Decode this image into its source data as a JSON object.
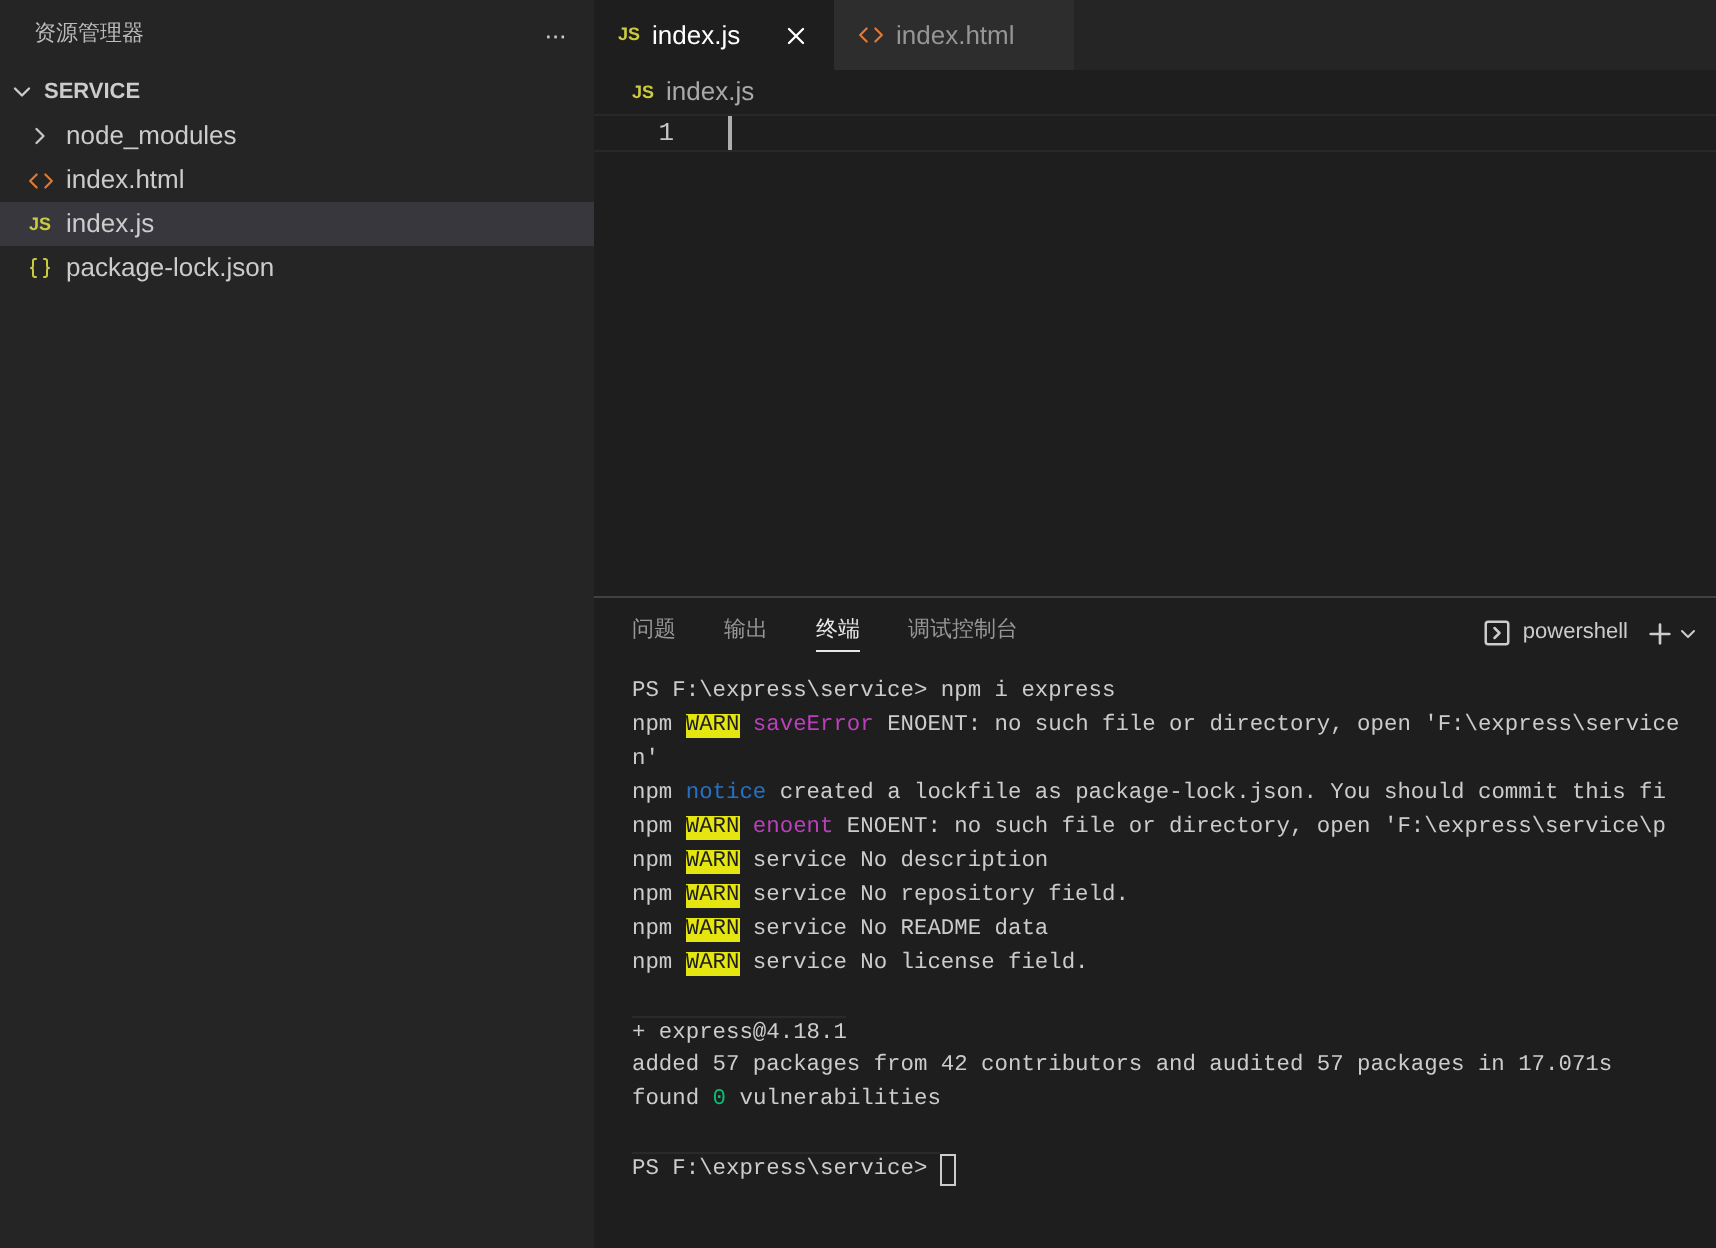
{
  "sidebar": {
    "title": "资源管理器",
    "more": "···",
    "folder": {
      "name": "SERVICE",
      "expanded": true
    },
    "items": [
      {
        "kind": "folder",
        "name": "node_modules",
        "selected": false
      },
      {
        "kind": "html",
        "name": "index.html",
        "selected": false
      },
      {
        "kind": "js",
        "icon_label": "JS",
        "name": "index.js",
        "selected": true
      },
      {
        "kind": "json",
        "name": "package-lock.json",
        "selected": false
      }
    ]
  },
  "tabs": [
    {
      "kind": "js",
      "icon_label": "JS",
      "label": "index.js",
      "selected": true
    },
    {
      "kind": "html",
      "label": "index.html",
      "selected": false
    }
  ],
  "breadcrumb": {
    "kind": "js",
    "icon_label": "JS",
    "label": "index.js"
  },
  "editor": {
    "line_numbers": [
      "1"
    ]
  },
  "panel": {
    "tabs": [
      {
        "label": "问题",
        "selected": false
      },
      {
        "label": "输出",
        "selected": false
      },
      {
        "label": "终端",
        "selected": true
      },
      {
        "label": "调试控制台",
        "selected": false
      }
    ],
    "shell": "powershell",
    "terminal": [
      {
        "segments": [
          {
            "kind": "plain",
            "text": "PS F:\\express\\service> npm i express"
          }
        ]
      },
      {
        "segments": [
          {
            "kind": "plain",
            "text": "npm "
          },
          {
            "kind": "warn",
            "text": "WARN"
          },
          {
            "kind": "keyword",
            "text": " saveError"
          },
          {
            "kind": "plain",
            "text": " ENOENT: no such file or directory, open 'F:\\express\\service"
          }
        ]
      },
      {
        "segments": [
          {
            "kind": "plain",
            "text": "n'"
          }
        ]
      },
      {
        "segments": [
          {
            "kind": "plain",
            "text": "npm "
          },
          {
            "kind": "notice",
            "text": "notice"
          },
          {
            "kind": "plain",
            "text": " created a lockfile as package-lock.json. You should commit this fi"
          }
        ]
      },
      {
        "segments": [
          {
            "kind": "plain",
            "text": "npm "
          },
          {
            "kind": "warn",
            "text": "WARN"
          },
          {
            "kind": "keyword",
            "text": " enoent"
          },
          {
            "kind": "plain",
            "text": " ENOENT: no such file or directory, open 'F:\\express\\service\\p"
          }
        ]
      },
      {
        "segments": [
          {
            "kind": "plain",
            "text": "npm "
          },
          {
            "kind": "warn",
            "text": "WARN"
          },
          {
            "kind": "plain",
            "text": " service No description"
          }
        ]
      },
      {
        "segments": [
          {
            "kind": "plain",
            "text": "npm "
          },
          {
            "kind": "warn",
            "text": "WARN"
          },
          {
            "kind": "plain",
            "text": " service No repository field."
          }
        ]
      },
      {
        "segments": [
          {
            "kind": "plain",
            "text": "npm "
          },
          {
            "kind": "warn",
            "text": "WARN"
          },
          {
            "kind": "plain",
            "text": " service No README data"
          }
        ]
      },
      {
        "segments": [
          {
            "kind": "plain",
            "text": "npm "
          },
          {
            "kind": "warn",
            "text": "WARN"
          },
          {
            "kind": "plain",
            "text": " service No license field."
          }
        ]
      },
      {
        "blank_before": true,
        "segments": [
          {
            "kind": "plain",
            "text": "+ express@4.18.1"
          }
        ]
      },
      {
        "segments": [
          {
            "kind": "plain",
            "text": "added 57 packages from 42 contributors and audited 57 packages in 17.071s"
          }
        ]
      },
      {
        "segments": [
          {
            "kind": "plain",
            "text": "found "
          },
          {
            "kind": "number",
            "text": "0"
          },
          {
            "kind": "plain",
            "text": " vulnerabilities"
          }
        ]
      },
      {
        "blank_before": true,
        "segments": [
          {
            "kind": "plain",
            "text": "PS F:\\express\\service> "
          }
        ],
        "cursor": true
      }
    ]
  }
}
